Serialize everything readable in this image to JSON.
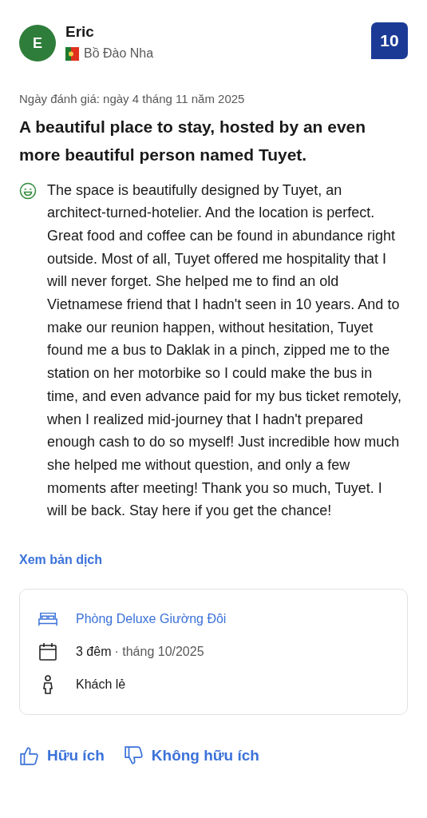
{
  "reviewer": {
    "initial": "E",
    "name": "Eric",
    "country": "Bồ Đào Nha"
  },
  "score": "10",
  "review_date": "Ngày đánh giá: ngày 4 tháng 11 năm 2025",
  "title": "A beautiful place to stay, hosted by an even more beautiful person named Tuyet.",
  "positive_text": "The space is beautifully designed by Tuyet, an architect-turned-hotelier. And the location is perfect. Great food and coffee can be found in abundance right outside. Most of all, Tuyet offered me hospitality that I will never forget. She helped me to find an old Vietnamese friend that I hadn't seen in 10 years. And to make our reunion happen, without hesitation, Tuyet found me a bus to Daklak in a pinch, zipped me to the station on her motorbike so I could make the bus in time, and even advance paid for my bus ticket remotely, when I realized mid-journey that I hadn't prepared enough cash to do so myself! Just incredible how much she helped me without question, and only a few moments after meeting! Thank you so much, Tuyet. I will be back. Stay here if you get the chance!",
  "translate_link": "Xem bản dịch",
  "stay_details": [
    {
      "kind": "room",
      "text": "Phòng Deluxe Giường Đôi"
    },
    {
      "kind": "stay",
      "text": "3 đêm",
      "detail": "· tháng 10/2025"
    },
    {
      "kind": "guest",
      "text": "Khách lẻ"
    }
  ],
  "helpful_buttons": [
    {
      "kind": "up",
      "label": "Hữu ích"
    },
    {
      "kind": "down",
      "label": "Không hữu ích"
    }
  ]
}
